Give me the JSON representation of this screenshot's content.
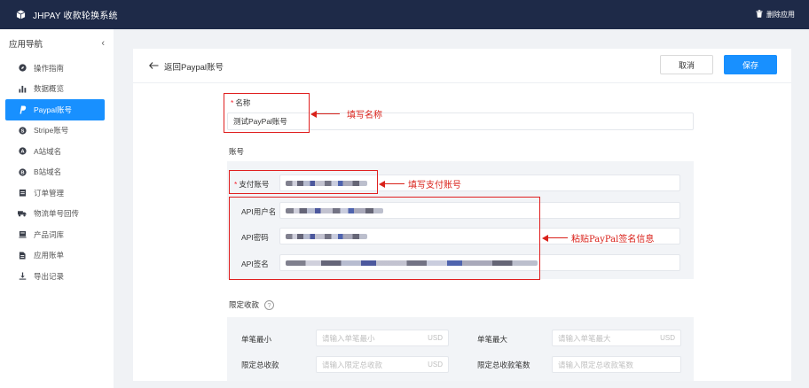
{
  "topbar": {
    "logo_icon": "cube-icon",
    "title": "JHPAY 收款轮换系统",
    "delete_label": "删除应用",
    "delete_icon": "trash-icon"
  },
  "sidebar": {
    "title": "应用导航",
    "collapse_icon": "chevron-left-icon",
    "items": [
      {
        "label": "操作指南",
        "icon": "compass-icon"
      },
      {
        "label": "数据概览",
        "icon": "bar-chart-icon"
      },
      {
        "label": "Paypal账号",
        "icon": "paypal-icon",
        "active": true
      },
      {
        "label": "Stripe账号",
        "icon": "stripe-icon"
      },
      {
        "label": "A站域名",
        "icon": "a-circle-icon"
      },
      {
        "label": "B站域名",
        "icon": "b-circle-icon"
      },
      {
        "label": "订单管理",
        "icon": "clipboard-icon"
      },
      {
        "label": "物流单号回传",
        "icon": "truck-icon"
      },
      {
        "label": "产品词库",
        "icon": "library-icon"
      },
      {
        "label": "应用账单",
        "icon": "bill-icon"
      },
      {
        "label": "导出记录",
        "icon": "download-icon"
      }
    ]
  },
  "header": {
    "back_label": "返回Paypal账号",
    "back_icon": "arrow-left-icon",
    "cancel_label": "取消",
    "save_label": "保存"
  },
  "form": {
    "name_label": "名称",
    "name_value": "测试PayPal账号",
    "account_section": "账号",
    "pay_account_label": "支付账号",
    "api_username_label": "API用户名",
    "api_password_label": "API密码",
    "api_signature_label": "API签名",
    "limit_section": "限定收款",
    "help_icon": "question-circle-icon",
    "min_label": "单笔最小",
    "min_placeholder": "请输入单笔最小",
    "max_label": "单笔最大",
    "max_placeholder": "请输入单笔最大",
    "total_amount_label": "限定总收款",
    "total_amount_placeholder": "请输入限定总收款",
    "total_count_label": "限定总收款笔数",
    "total_count_placeholder": "请输入限定总收款笔数",
    "currency": "USD"
  },
  "annotations": {
    "name_note": "填写名称",
    "account_note": "填写支付账号",
    "signature_note": "粘贴PayPal签名信息",
    "color": "#d9211a"
  },
  "colors": {
    "primary": "#1890ff",
    "topbar": "#1e2a48",
    "annotation": "#e02020"
  }
}
